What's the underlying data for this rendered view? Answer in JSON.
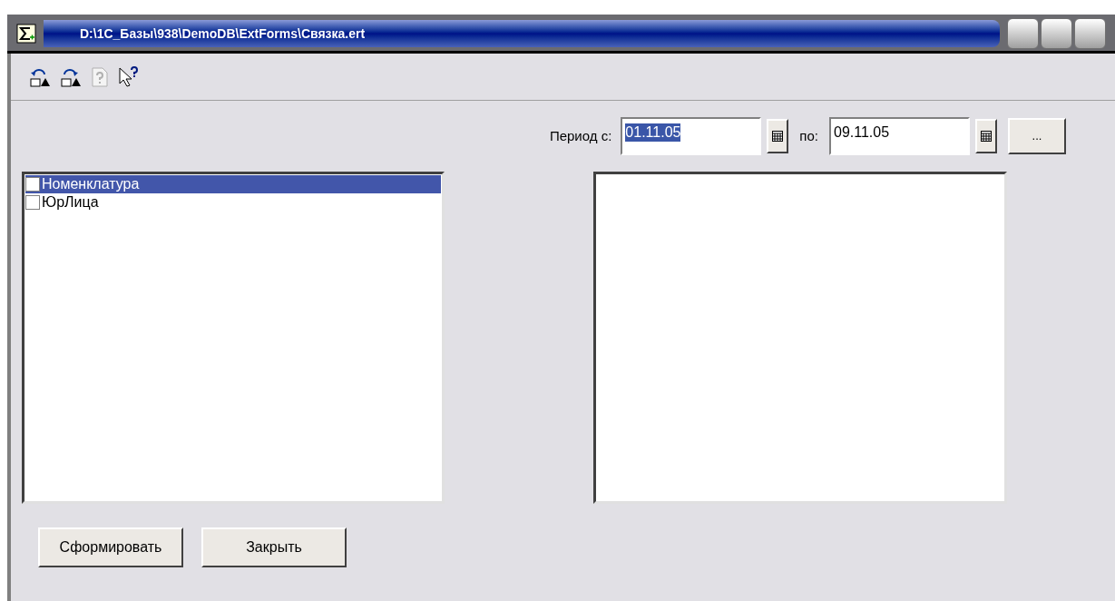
{
  "window": {
    "title": "D:\\1C_Базы\\938\\DemoDB\\ExtForms\\Связка.ert"
  },
  "period": {
    "from_label": "Период с:",
    "from_value": "01.11.05",
    "to_label": "по:",
    "to_value": "09.11.05",
    "more_button": "..."
  },
  "list": [
    {
      "label": "Номенклатура",
      "checked": false,
      "selected": true
    },
    {
      "label": "ЮрЛица",
      "checked": false,
      "selected": false
    }
  ],
  "buttons": [
    "Сформировать",
    "Закрыть"
  ]
}
